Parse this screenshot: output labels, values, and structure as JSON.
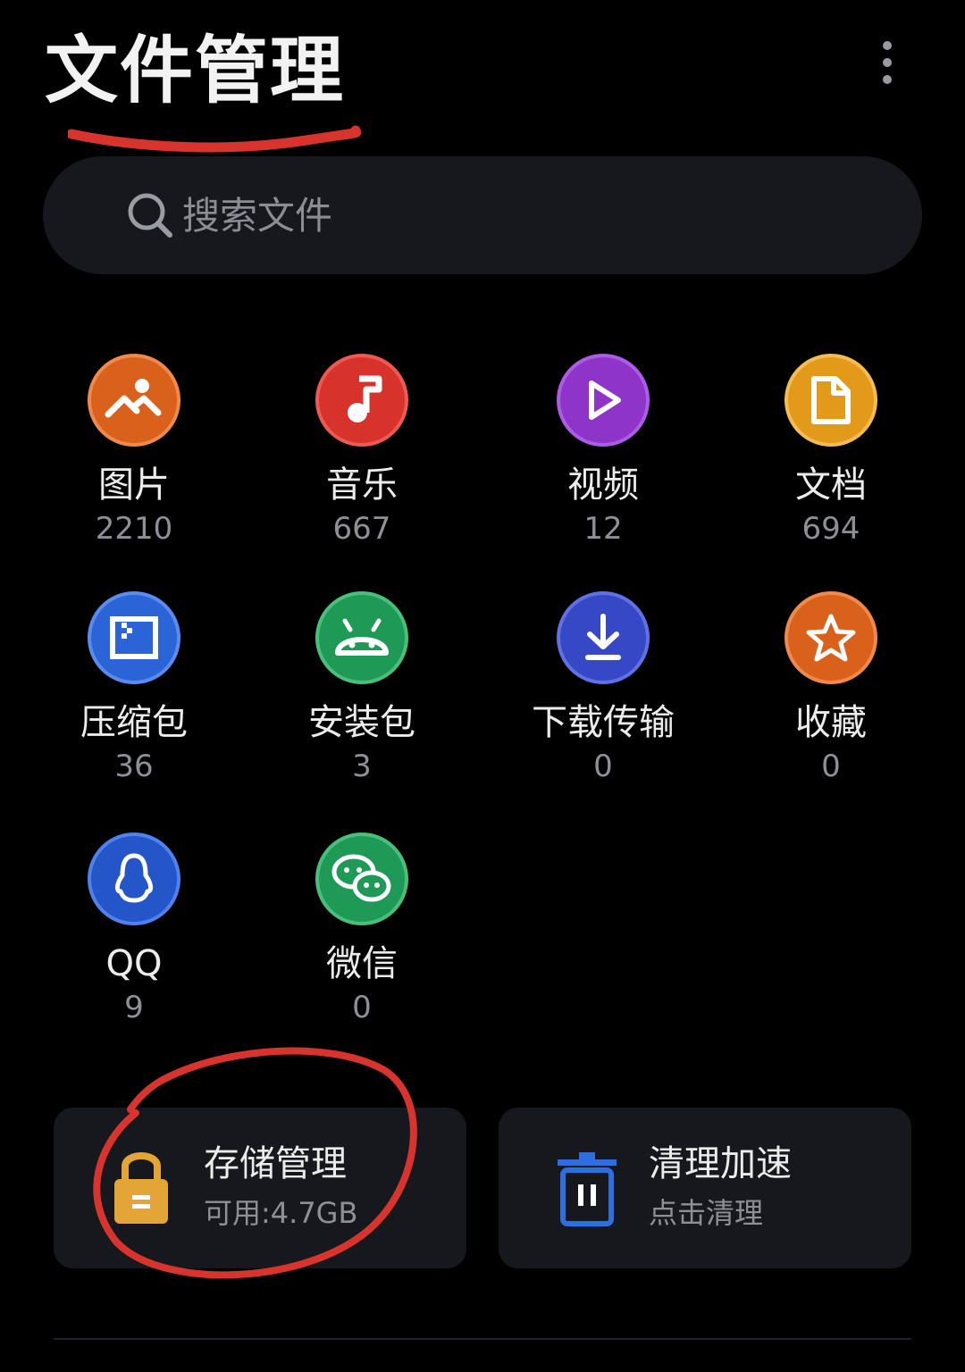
{
  "header": {
    "title": "文件管理",
    "more_icon": "more-vertical-icon"
  },
  "search": {
    "placeholder": "搜索文件",
    "icon": "search-icon"
  },
  "categories": [
    {
      "label": "图片",
      "count": "2210",
      "icon": "image-icon",
      "color": "#d9611b"
    },
    {
      "label": "音乐",
      "count": "667",
      "icon": "music-icon",
      "color": "#d8322c"
    },
    {
      "label": "视频",
      "count": "12",
      "icon": "play-icon",
      "color": "#8e34c9"
    },
    {
      "label": "文档",
      "count": "694",
      "icon": "document-icon",
      "color": "#e39a1a"
    },
    {
      "label": "压缩包",
      "count": "36",
      "icon": "archive-icon",
      "color": "#2b64d6"
    },
    {
      "label": "安装包",
      "count": "3",
      "icon": "android-icon",
      "color": "#1f9a56"
    },
    {
      "label": "下载传输",
      "count": "0",
      "icon": "download-icon",
      "color": "#3748c6"
    },
    {
      "label": "收藏",
      "count": "0",
      "icon": "star-icon",
      "color": "#d9611b"
    },
    {
      "label": "QQ",
      "count": "9",
      "icon": "qq-icon",
      "color": "#2456c9"
    },
    {
      "label": "微信",
      "count": "0",
      "icon": "wechat-icon",
      "color": "#1f9a56"
    }
  ],
  "cards": {
    "storage": {
      "title": "存储管理",
      "subtitle": "可用:4.7GB",
      "icon": "lock-icon",
      "color": "#e3a535"
    },
    "clean": {
      "title": "清理加速",
      "subtitle": "点击清理",
      "icon": "trash-icon",
      "color": "#2d6fe0"
    }
  },
  "annotation_color": "#d7342e"
}
